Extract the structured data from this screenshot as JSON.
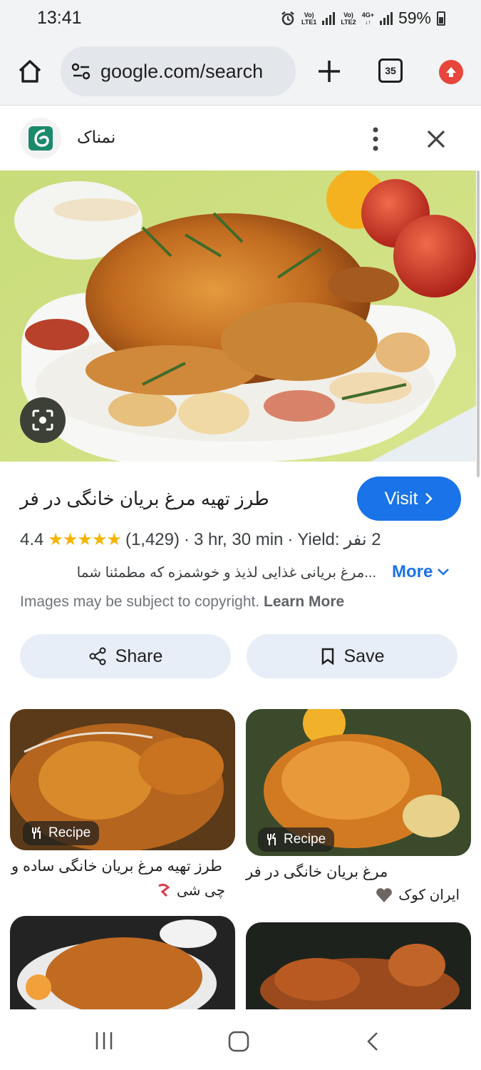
{
  "status_bar": {
    "time": "13:41",
    "sim1": "LTE1",
    "sim2": "LTE2",
    "network": "4G+",
    "volte": "Vo)",
    "battery": "59%"
  },
  "browser": {
    "url": "google.com/search",
    "tab_count": "35"
  },
  "panel": {
    "site_name": "نمناک"
  },
  "result": {
    "title": "طرز تهیه مرغ بریان خانگی در فر",
    "visit_label": "Visit",
    "rating": "4.4",
    "stars": "★★★★★",
    "reviews": "(1,429)",
    "separator": "·",
    "duration": "3 hr, 30 min",
    "yield_label": "Yield:",
    "yield_value": "2 نفر",
    "description": "...مرغ بریانی غذایی لذیذ و خوشمزه که مطمئنا شما",
    "more_label": "More",
    "copyright_text": "Images may be subject to copyright.",
    "learn_more": "Learn More"
  },
  "actions": {
    "share_label": "Share",
    "save_label": "Save"
  },
  "related": [
    {
      "chip": "Recipe",
      "title": "طرز تهیه مرغ بریان خانگی ساده و",
      "source": "چی شی"
    },
    {
      "chip": "Recipe",
      "title": "مرغ بریان خانگی در فر",
      "source": "ایران کوک"
    }
  ],
  "colors": {
    "accent": "#1a73e8",
    "star": "#f4b400",
    "update": "#e8453c",
    "chip_bg": "#e8eef8"
  },
  "icons": {
    "home": "home-icon",
    "tune": "tune-icon",
    "plus": "plus-icon",
    "tabs": "tabs-icon",
    "update": "update-arrow-icon",
    "more": "more-vert-icon",
    "close": "close-icon",
    "lens": "lens-icon",
    "share": "share-icon",
    "save": "bookmark-icon",
    "recipe": "utensils-icon"
  }
}
